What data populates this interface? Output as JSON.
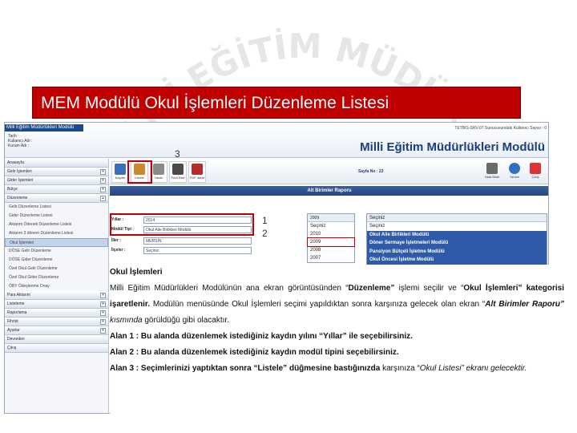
{
  "watermark": {
    "text": "LİLİ EĞİTİM MÜDÜR"
  },
  "title": "MEM Modülü Okul İşlemleri Düzenleme Listesi",
  "app": {
    "mini_title": "Milli Eğitim Müdürlükleri Modülü",
    "info": [
      "Tarih :",
      "Kullanıcı Adı :",
      "Kurum Adı :"
    ],
    "server": "TETBIS-SRV-07 Sunucusundaki Kullanıcı Sayısı : 0",
    "big_title": "Milli Eğitim Müdürlükleri Modülü",
    "label_3": "3"
  },
  "sidebar": {
    "items": [
      {
        "label": "Anasayfa",
        "kind": "group"
      },
      {
        "label": "Gelir İşlemleri",
        "kind": "group"
      },
      {
        "label": "Gider İşlemleri",
        "kind": "group"
      },
      {
        "label": "Bütçe",
        "kind": "group"
      },
      {
        "label": "Düzenleme",
        "kind": "group"
      },
      {
        "label": "Gelir Düzenleme Listesi",
        "kind": "sub"
      },
      {
        "label": "Gider Düzenleme Listesi",
        "kind": "sub"
      },
      {
        "label": "Aktarım Ödenek Düzenleme Listesi",
        "kind": "sub"
      },
      {
        "label": "Aktarım 3 dönem Düzenleme Listesi",
        "kind": "sub"
      },
      {
        "label": "Okul İşlemleri",
        "kind": "active"
      },
      {
        "label": "DÖSE Gelir Düzenleme",
        "kind": "sub"
      },
      {
        "label": "DÖSE Gider Düzenleme",
        "kind": "sub"
      },
      {
        "label": "Özel Okul Gelir Düzenleme",
        "kind": "sub"
      },
      {
        "label": "Özel Okul Gider Düzenleme",
        "kind": "sub"
      },
      {
        "label": "ÖBY Ödeşlenme Onay",
        "kind": "sub"
      },
      {
        "label": "Para Aktarım",
        "kind": "group"
      },
      {
        "label": "Listeleme",
        "kind": "group"
      },
      {
        "label": "Raporlama",
        "kind": "group"
      },
      {
        "label": "Fihrist",
        "kind": "group"
      },
      {
        "label": "Ayarlar",
        "kind": "group"
      },
      {
        "label": "Devreden",
        "kind": "group"
      },
      {
        "label": "Çıkış",
        "kind": "group"
      }
    ]
  },
  "toolbar": {
    "buttons": [
      "Kaydet",
      "Listele",
      "Yazdır",
      "Print Ekle",
      "PDF Aktar"
    ],
    "page_label": "Sayfa No : 23",
    "right_buttons": [
      "Hata Bildir",
      "Yardım",
      "Çıkış"
    ]
  },
  "report_bar": "Alt Birimler Raporu",
  "form": {
    "rows": [
      {
        "label": "Yıllar :",
        "value": "2014"
      },
      {
        "label": "Modül Tipi :",
        "value": "Okul Aile Birlikleri Modülü"
      },
      {
        "label": "İller :",
        "value": "MERSİN"
      },
      {
        "label": "İlçeler :",
        "value": "Seçiniz"
      }
    ],
    "num1": "1",
    "num2": "2",
    "list_a": {
      "header": "2009",
      "items": [
        "Seçiniz",
        "2010",
        "2009",
        "2008",
        "2007"
      ]
    },
    "list_b": {
      "header": "Seçiniz",
      "items": [
        "Seçiniz",
        "Okul Aile Birlikleri Modülü",
        "Döner Sermaye İşletmeleri Modülü",
        "Pansiyon Bütçeli İşletme Modülü",
        "Okul Öncesi İşletme Modülü"
      ]
    },
    "status": "Seçiminize istediğiniz bilgiler listelenmektedir."
  },
  "desc": {
    "heading": "Okul İşlemleri",
    "p1_a": "Milli Eğitim Müdürlükleri Modülünün ana ekran görüntüsünden “",
    "p1_b": "Düzenleme”",
    "p1_c": " işlemi seçilir ve “",
    "p1_d": "Okul İşlemleri”",
    "p1_e": " kategorisi işaretlenir.",
    "p1_f": " Modülün menüsünde Okul İşlemleri seçimi yapıldıktan sonra karşınıza gelecek olan ekran “",
    "p1_g": "Alt Birimler Raporu”",
    "p1_h": " kısmında",
    "p1_i": " görüldüğü gibi olacaktır.",
    "a1": "Alan 1 : Bu alanda düzenlemek istediğiniz kaydın yılını “Yıllar” ile seçebilirsiniz.",
    "a2": "Alan 2 : Bu alanda düzenlemek istediğiniz kaydın modül tipini seçebilirsiniz.",
    "a3_a": "Alan 3 : Seçimlerinizi yaptıktan sonra “Listele” düğmesine bastığınızda",
    "a3_b": " karşınıza “",
    "a3_c": "Okul Listesi",
    "a3_d": "” ekranı gelecektir."
  },
  "colors": {
    "title_bg": "#c00000",
    "header_blue": "#1b3f7a",
    "highlight_red": "#c00000",
    "list_selected": "#2f5aa8"
  }
}
